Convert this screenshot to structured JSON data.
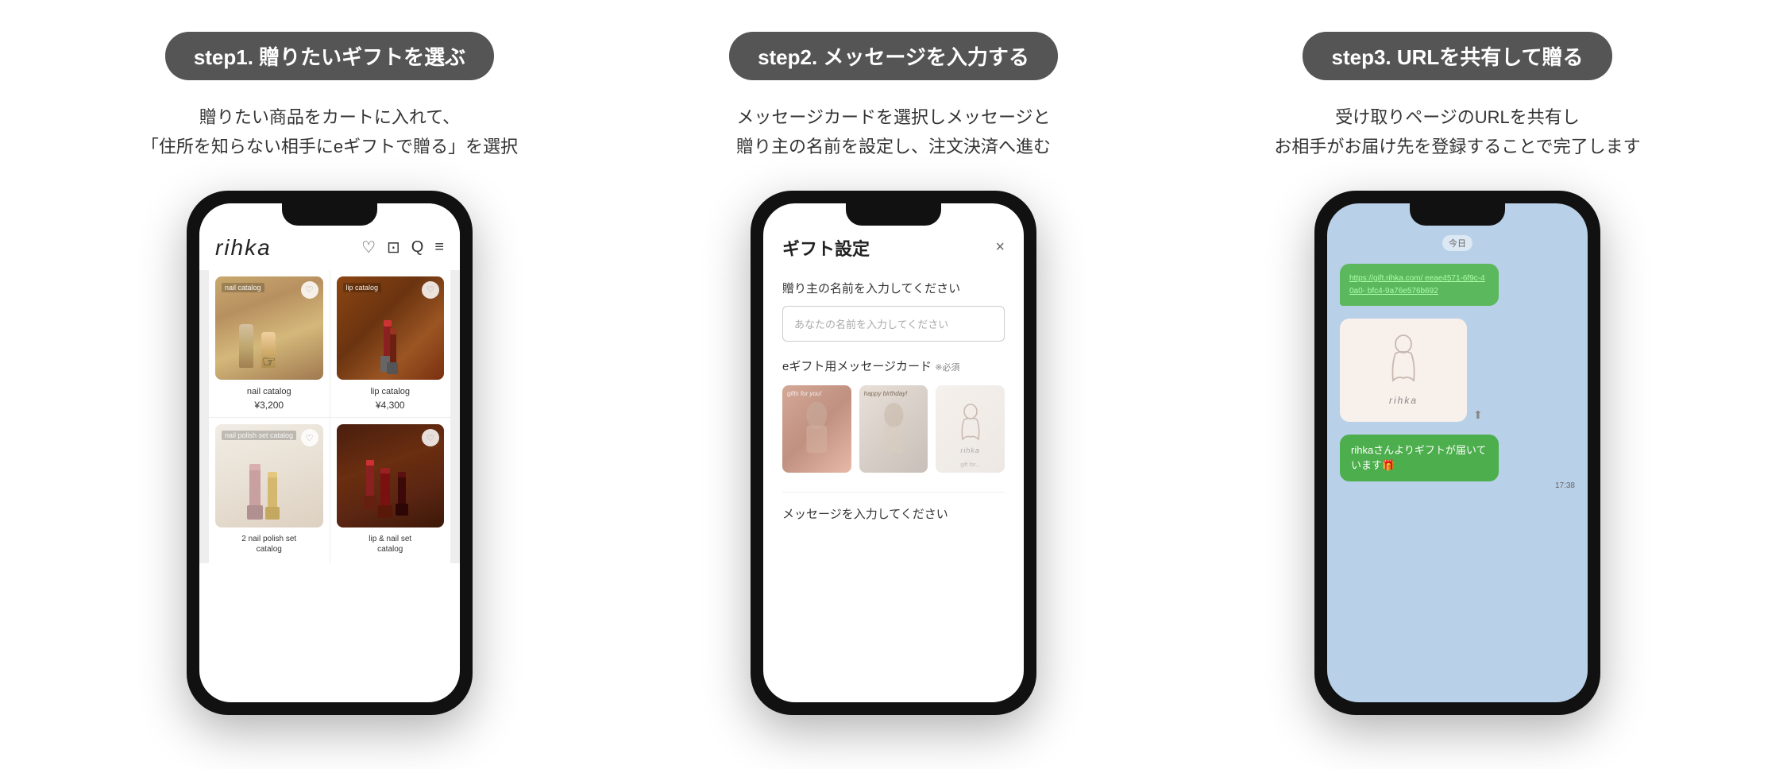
{
  "steps": [
    {
      "id": "step1",
      "badge": "step1. 贈りたいギフトを選ぶ",
      "description_line1": "贈りたい商品をカートに入れて、",
      "description_line2": "「住所を知らない相手にeギフトで贈る」を選択",
      "phone": {
        "app_logo": "rihka",
        "header_icons": [
          "♡",
          "□",
          "Q",
          "≡"
        ],
        "products": [
          {
            "label": "nail catalog",
            "price": "¥3,200",
            "type": "nail-catalog",
            "label_overlay": "nail catalog"
          },
          {
            "label": "lip catalog",
            "price": "¥4,300",
            "type": "lip-catalog",
            "label_overlay": "lip catalog"
          },
          {
            "label": "2 nail polish set\ncatalog",
            "price": "",
            "type": "nail-set",
            "label_overlay": "nail polish set catalog"
          },
          {
            "label": "lip & nail set\ncatalog",
            "price": "",
            "type": "lip-nail-set",
            "label_overlay": ""
          }
        ]
      }
    },
    {
      "id": "step2",
      "badge": "step2. メッセージを入力する",
      "description_line1": "メッセージカードを選択しメッセージと",
      "description_line2": "贈り主の名前を設定し、注文決済へ進む",
      "phone": {
        "dialog_title": "ギフト設定",
        "close_icon": "×",
        "sender_label": "贈り主の名前を入力してください",
        "sender_placeholder": "あなたの名前を入力してください",
        "card_section_label": "eギフト用メッセージカード ※必須",
        "required_text": "※必須",
        "message_section_label": "メッセージを入力してください",
        "card_labels": [
          "gifts for you!",
          "happy birthday!",
          "rihka"
        ]
      }
    },
    {
      "id": "step3",
      "badge": "step3. URLを共有して贈る",
      "description_line1": "受け取りページのURLを共有し",
      "description_line2": "お相手がお届け先を登録することで完了します",
      "phone": {
        "chat_time": "今日",
        "url_bubble": "https://gift.rihka.com/\neeae4571-6f9c-40a0-\nbfc4-9a76e576b692",
        "brand_name": "rihka",
        "gift_message": "rihkaさんよりギフトが届いています🎁",
        "timestamp": "17:38"
      }
    }
  ]
}
